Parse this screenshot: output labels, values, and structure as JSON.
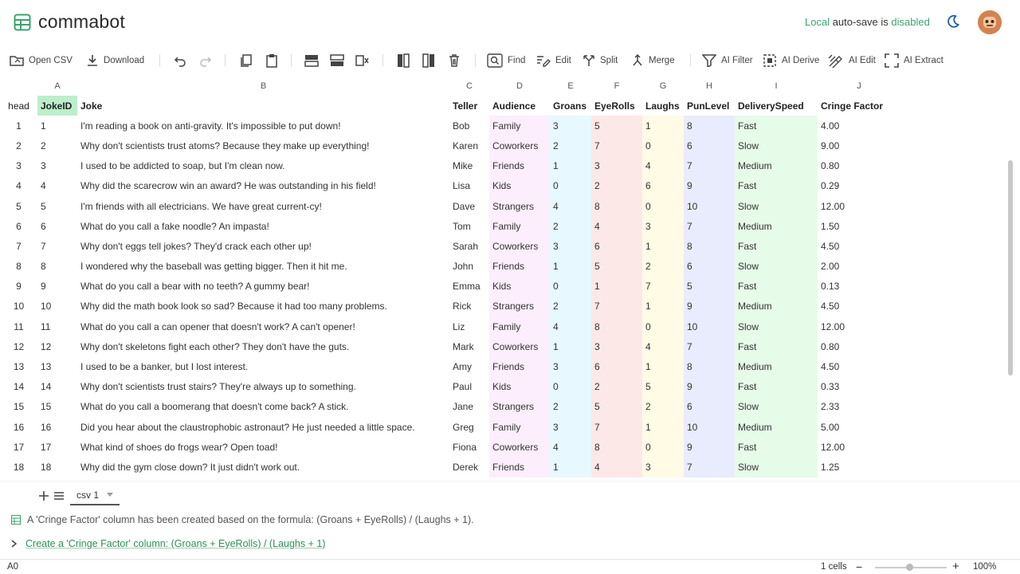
{
  "app": {
    "name": "commabot"
  },
  "autosave": {
    "prefix": "Local",
    "middle": " auto-save is ",
    "state": "disabled"
  },
  "toolbar": {
    "open_csv": "Open CSV",
    "download": "Download",
    "find": "Find",
    "edit": "Edit",
    "split": "Split",
    "merge": "Merge",
    "ai_filter": "AI Filter",
    "ai_derive": "AI Derive",
    "ai_edit": "AI Edit",
    "ai_extract": "AI Extract"
  },
  "grid": {
    "col_letters": [
      "A",
      "B",
      "C",
      "D",
      "E",
      "F",
      "G",
      "H",
      "I",
      "J"
    ],
    "head_label": "head",
    "headers": [
      "JokeID",
      "Joke",
      "Teller",
      "Audience",
      "Groans",
      "EyeRolls",
      "Laughs",
      "PunLevel",
      "DeliverySpeed",
      "Cringe Factor"
    ],
    "rows": [
      [
        "1",
        "I'm reading a book on anti-gravity. It's impossible to put down!",
        "Bob",
        "Family",
        "3",
        "5",
        "1",
        "8",
        "Fast",
        "4.00"
      ],
      [
        "2",
        "Why don't scientists trust atoms? Because they make up everything!",
        "Karen",
        "Coworkers",
        "2",
        "7",
        "0",
        "6",
        "Slow",
        "9.00"
      ],
      [
        "3",
        "I used to be addicted to soap, but I'm clean now.",
        "Mike",
        "Friends",
        "1",
        "3",
        "4",
        "7",
        "Medium",
        "0.80"
      ],
      [
        "4",
        "Why did the scarecrow win an award? He was outstanding in his field!",
        "Lisa",
        "Kids",
        "0",
        "2",
        "6",
        "9",
        "Fast",
        "0.29"
      ],
      [
        "5",
        "I'm friends with all electricians. We have great current-cy!",
        "Dave",
        "Strangers",
        "4",
        "8",
        "0",
        "10",
        "Slow",
        "12.00"
      ],
      [
        "6",
        "What do you call a fake noodle? An impasta!",
        "Tom",
        "Family",
        "2",
        "4",
        "3",
        "7",
        "Medium",
        "1.50"
      ],
      [
        "7",
        "Why don't eggs tell jokes? They'd crack each other up!",
        "Sarah",
        "Coworkers",
        "3",
        "6",
        "1",
        "8",
        "Fast",
        "4.50"
      ],
      [
        "8",
        "I wondered why the baseball was getting bigger. Then it hit me.",
        "John",
        "Friends",
        "1",
        "5",
        "2",
        "6",
        "Slow",
        "2.00"
      ],
      [
        "9",
        "What do you call a bear with no teeth? A gummy bear!",
        "Emma",
        "Kids",
        "0",
        "1",
        "7",
        "5",
        "Fast",
        "0.13"
      ],
      [
        "10",
        "Why did the math book look so sad? Because it had too many problems.",
        "Rick",
        "Strangers",
        "2",
        "7",
        "1",
        "9",
        "Medium",
        "4.50"
      ],
      [
        "11",
        "What do you call a can opener that doesn't work? A can't opener!",
        "Liz",
        "Family",
        "4",
        "8",
        "0",
        "10",
        "Slow",
        "12.00"
      ],
      [
        "12",
        "Why don't skeletons fight each other? They don't have the guts.",
        "Mark",
        "Coworkers",
        "1",
        "3",
        "4",
        "7",
        "Fast",
        "0.80"
      ],
      [
        "13",
        "I used to be a banker, but I lost interest.",
        "Amy",
        "Friends",
        "3",
        "6",
        "1",
        "8",
        "Medium",
        "4.50"
      ],
      [
        "14",
        "Why don't scientists trust stairs? They're always up to something.",
        "Paul",
        "Kids",
        "0",
        "2",
        "5",
        "9",
        "Fast",
        "0.33"
      ],
      [
        "15",
        "What do you call a boomerang that doesn't come back? A stick.",
        "Jane",
        "Strangers",
        "2",
        "5",
        "2",
        "6",
        "Slow",
        "2.33"
      ],
      [
        "16",
        "Did you hear about the claustrophobic astronaut? He just needed a little space.",
        "Greg",
        "Family",
        "3",
        "7",
        "1",
        "10",
        "Medium",
        "5.00"
      ],
      [
        "17",
        "What kind of shoes do frogs wear? Open toad!",
        "Fiona",
        "Coworkers",
        "4",
        "8",
        "0",
        "9",
        "Fast",
        "12.00"
      ],
      [
        "18",
        "Why did the gym close down? It just didn't work out.",
        "Derek",
        "Friends",
        "1",
        "4",
        "3",
        "7",
        "Slow",
        "1.25"
      ]
    ],
    "col_colors": [
      "#ffffff",
      "#ffffff",
      "#ffffff",
      "#fdeefd",
      "#e8f8ff",
      "#fde8e8",
      "#fffbe5",
      "#e9ecfd",
      "#e6fbe8",
      "#ffffff"
    ]
  },
  "sheet": {
    "tab_name": "csv 1"
  },
  "messages": {
    "result": "A 'Cringe Factor' column has been created based on the formula: (Groans + EyeRolls) / (Laughs + 1).",
    "command": "Create a 'Cringe Factor' column: (Groans + EyeRolls) / (Laughs + 1)"
  },
  "status": {
    "cell_ref": "A0",
    "cell_count": "1 cells",
    "zoom": "100%"
  },
  "colors": {
    "accent": "#3aa56b",
    "selected_header": "#bdeecb"
  }
}
